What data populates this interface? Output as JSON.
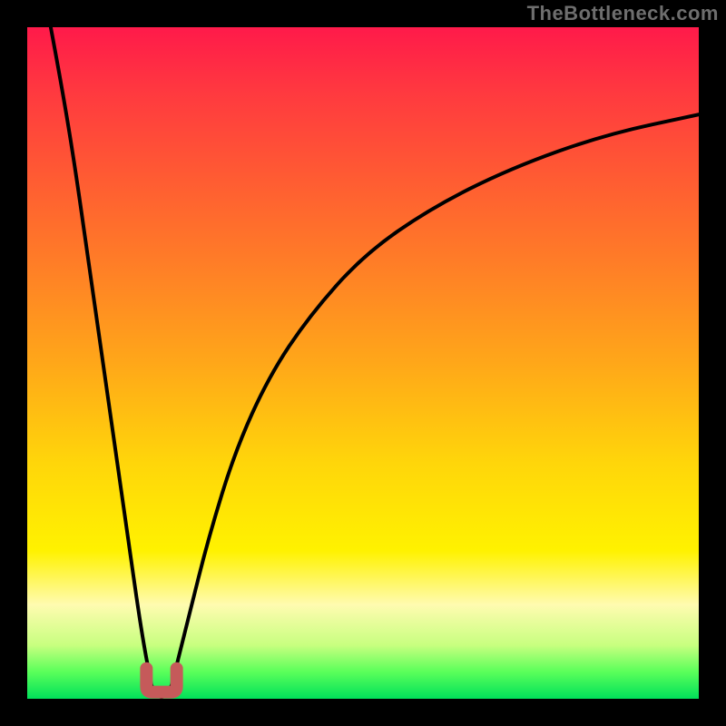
{
  "attribution": "TheBottleneck.com",
  "colors": {
    "page_bg": "#000000",
    "gradient_top": "#ff1a4a",
    "gradient_bottom": "#00e05a",
    "curve": "#000000",
    "mark": "#c55a5a"
  },
  "chart_data": {
    "type": "line",
    "title": "",
    "xlabel": "",
    "ylabel": "",
    "xlim": [
      0,
      100
    ],
    "ylim": [
      0,
      100
    ],
    "grid": false,
    "legend": false,
    "note": "No axes/ticks/labels visible. x/y are percentage of plot area; y=0 at bottom, y=100 at top. Values are visual estimates.",
    "series": [
      {
        "name": "left-branch",
        "x": [
          3.5,
          5,
          7,
          9,
          11,
          13,
          15,
          17,
          18.5
        ],
        "y": [
          100,
          92,
          80,
          66,
          52,
          38,
          24,
          10,
          2
        ]
      },
      {
        "name": "right-branch",
        "x": [
          21.5,
          24,
          27,
          31,
          36,
          42,
          50,
          60,
          72,
          86,
          100
        ],
        "y": [
          2,
          12,
          24,
          37,
          48,
          57,
          66,
          73,
          79,
          84,
          87
        ]
      },
      {
        "name": "valley-floor",
        "x": [
          18.5,
          19.3,
          20.0,
          20.7,
          21.5
        ],
        "y": [
          2,
          0.5,
          0.2,
          0.5,
          2
        ]
      }
    ],
    "marker": {
      "name": "valley-mark",
      "shape": "U",
      "x_center": 20,
      "y_center": 1,
      "width_pct": 4.5,
      "height_pct": 3.5
    }
  }
}
